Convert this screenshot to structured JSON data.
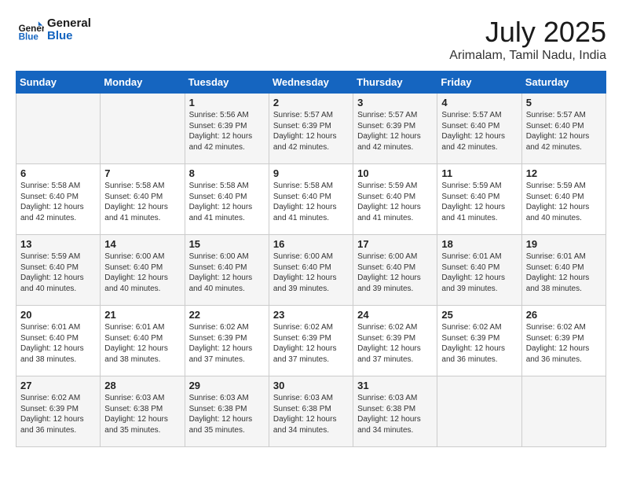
{
  "header": {
    "logo_line1": "General",
    "logo_line2": "Blue",
    "month_title": "July 2025",
    "location": "Arimalam, Tamil Nadu, India"
  },
  "weekdays": [
    "Sunday",
    "Monday",
    "Tuesday",
    "Wednesday",
    "Thursday",
    "Friday",
    "Saturday"
  ],
  "rows": [
    [
      {
        "day": "",
        "info": ""
      },
      {
        "day": "",
        "info": ""
      },
      {
        "day": "1",
        "info": "Sunrise: 5:56 AM\nSunset: 6:39 PM\nDaylight: 12 hours and 42 minutes."
      },
      {
        "day": "2",
        "info": "Sunrise: 5:57 AM\nSunset: 6:39 PM\nDaylight: 12 hours and 42 minutes."
      },
      {
        "day": "3",
        "info": "Sunrise: 5:57 AM\nSunset: 6:39 PM\nDaylight: 12 hours and 42 minutes."
      },
      {
        "day": "4",
        "info": "Sunrise: 5:57 AM\nSunset: 6:40 PM\nDaylight: 12 hours and 42 minutes."
      },
      {
        "day": "5",
        "info": "Sunrise: 5:57 AM\nSunset: 6:40 PM\nDaylight: 12 hours and 42 minutes."
      }
    ],
    [
      {
        "day": "6",
        "info": "Sunrise: 5:58 AM\nSunset: 6:40 PM\nDaylight: 12 hours and 42 minutes."
      },
      {
        "day": "7",
        "info": "Sunrise: 5:58 AM\nSunset: 6:40 PM\nDaylight: 12 hours and 41 minutes."
      },
      {
        "day": "8",
        "info": "Sunrise: 5:58 AM\nSunset: 6:40 PM\nDaylight: 12 hours and 41 minutes."
      },
      {
        "day": "9",
        "info": "Sunrise: 5:58 AM\nSunset: 6:40 PM\nDaylight: 12 hours and 41 minutes."
      },
      {
        "day": "10",
        "info": "Sunrise: 5:59 AM\nSunset: 6:40 PM\nDaylight: 12 hours and 41 minutes."
      },
      {
        "day": "11",
        "info": "Sunrise: 5:59 AM\nSunset: 6:40 PM\nDaylight: 12 hours and 41 minutes."
      },
      {
        "day": "12",
        "info": "Sunrise: 5:59 AM\nSunset: 6:40 PM\nDaylight: 12 hours and 40 minutes."
      }
    ],
    [
      {
        "day": "13",
        "info": "Sunrise: 5:59 AM\nSunset: 6:40 PM\nDaylight: 12 hours and 40 minutes."
      },
      {
        "day": "14",
        "info": "Sunrise: 6:00 AM\nSunset: 6:40 PM\nDaylight: 12 hours and 40 minutes."
      },
      {
        "day": "15",
        "info": "Sunrise: 6:00 AM\nSunset: 6:40 PM\nDaylight: 12 hours and 40 minutes."
      },
      {
        "day": "16",
        "info": "Sunrise: 6:00 AM\nSunset: 6:40 PM\nDaylight: 12 hours and 39 minutes."
      },
      {
        "day": "17",
        "info": "Sunrise: 6:00 AM\nSunset: 6:40 PM\nDaylight: 12 hours and 39 minutes."
      },
      {
        "day": "18",
        "info": "Sunrise: 6:01 AM\nSunset: 6:40 PM\nDaylight: 12 hours and 39 minutes."
      },
      {
        "day": "19",
        "info": "Sunrise: 6:01 AM\nSunset: 6:40 PM\nDaylight: 12 hours and 38 minutes."
      }
    ],
    [
      {
        "day": "20",
        "info": "Sunrise: 6:01 AM\nSunset: 6:40 PM\nDaylight: 12 hours and 38 minutes."
      },
      {
        "day": "21",
        "info": "Sunrise: 6:01 AM\nSunset: 6:40 PM\nDaylight: 12 hours and 38 minutes."
      },
      {
        "day": "22",
        "info": "Sunrise: 6:02 AM\nSunset: 6:39 PM\nDaylight: 12 hours and 37 minutes."
      },
      {
        "day": "23",
        "info": "Sunrise: 6:02 AM\nSunset: 6:39 PM\nDaylight: 12 hours and 37 minutes."
      },
      {
        "day": "24",
        "info": "Sunrise: 6:02 AM\nSunset: 6:39 PM\nDaylight: 12 hours and 37 minutes."
      },
      {
        "day": "25",
        "info": "Sunrise: 6:02 AM\nSunset: 6:39 PM\nDaylight: 12 hours and 36 minutes."
      },
      {
        "day": "26",
        "info": "Sunrise: 6:02 AM\nSunset: 6:39 PM\nDaylight: 12 hours and 36 minutes."
      }
    ],
    [
      {
        "day": "27",
        "info": "Sunrise: 6:02 AM\nSunset: 6:39 PM\nDaylight: 12 hours and 36 minutes."
      },
      {
        "day": "28",
        "info": "Sunrise: 6:03 AM\nSunset: 6:38 PM\nDaylight: 12 hours and 35 minutes."
      },
      {
        "day": "29",
        "info": "Sunrise: 6:03 AM\nSunset: 6:38 PM\nDaylight: 12 hours and 35 minutes."
      },
      {
        "day": "30",
        "info": "Sunrise: 6:03 AM\nSunset: 6:38 PM\nDaylight: 12 hours and 34 minutes."
      },
      {
        "day": "31",
        "info": "Sunrise: 6:03 AM\nSunset: 6:38 PM\nDaylight: 12 hours and 34 minutes."
      },
      {
        "day": "",
        "info": ""
      },
      {
        "day": "",
        "info": ""
      }
    ]
  ]
}
